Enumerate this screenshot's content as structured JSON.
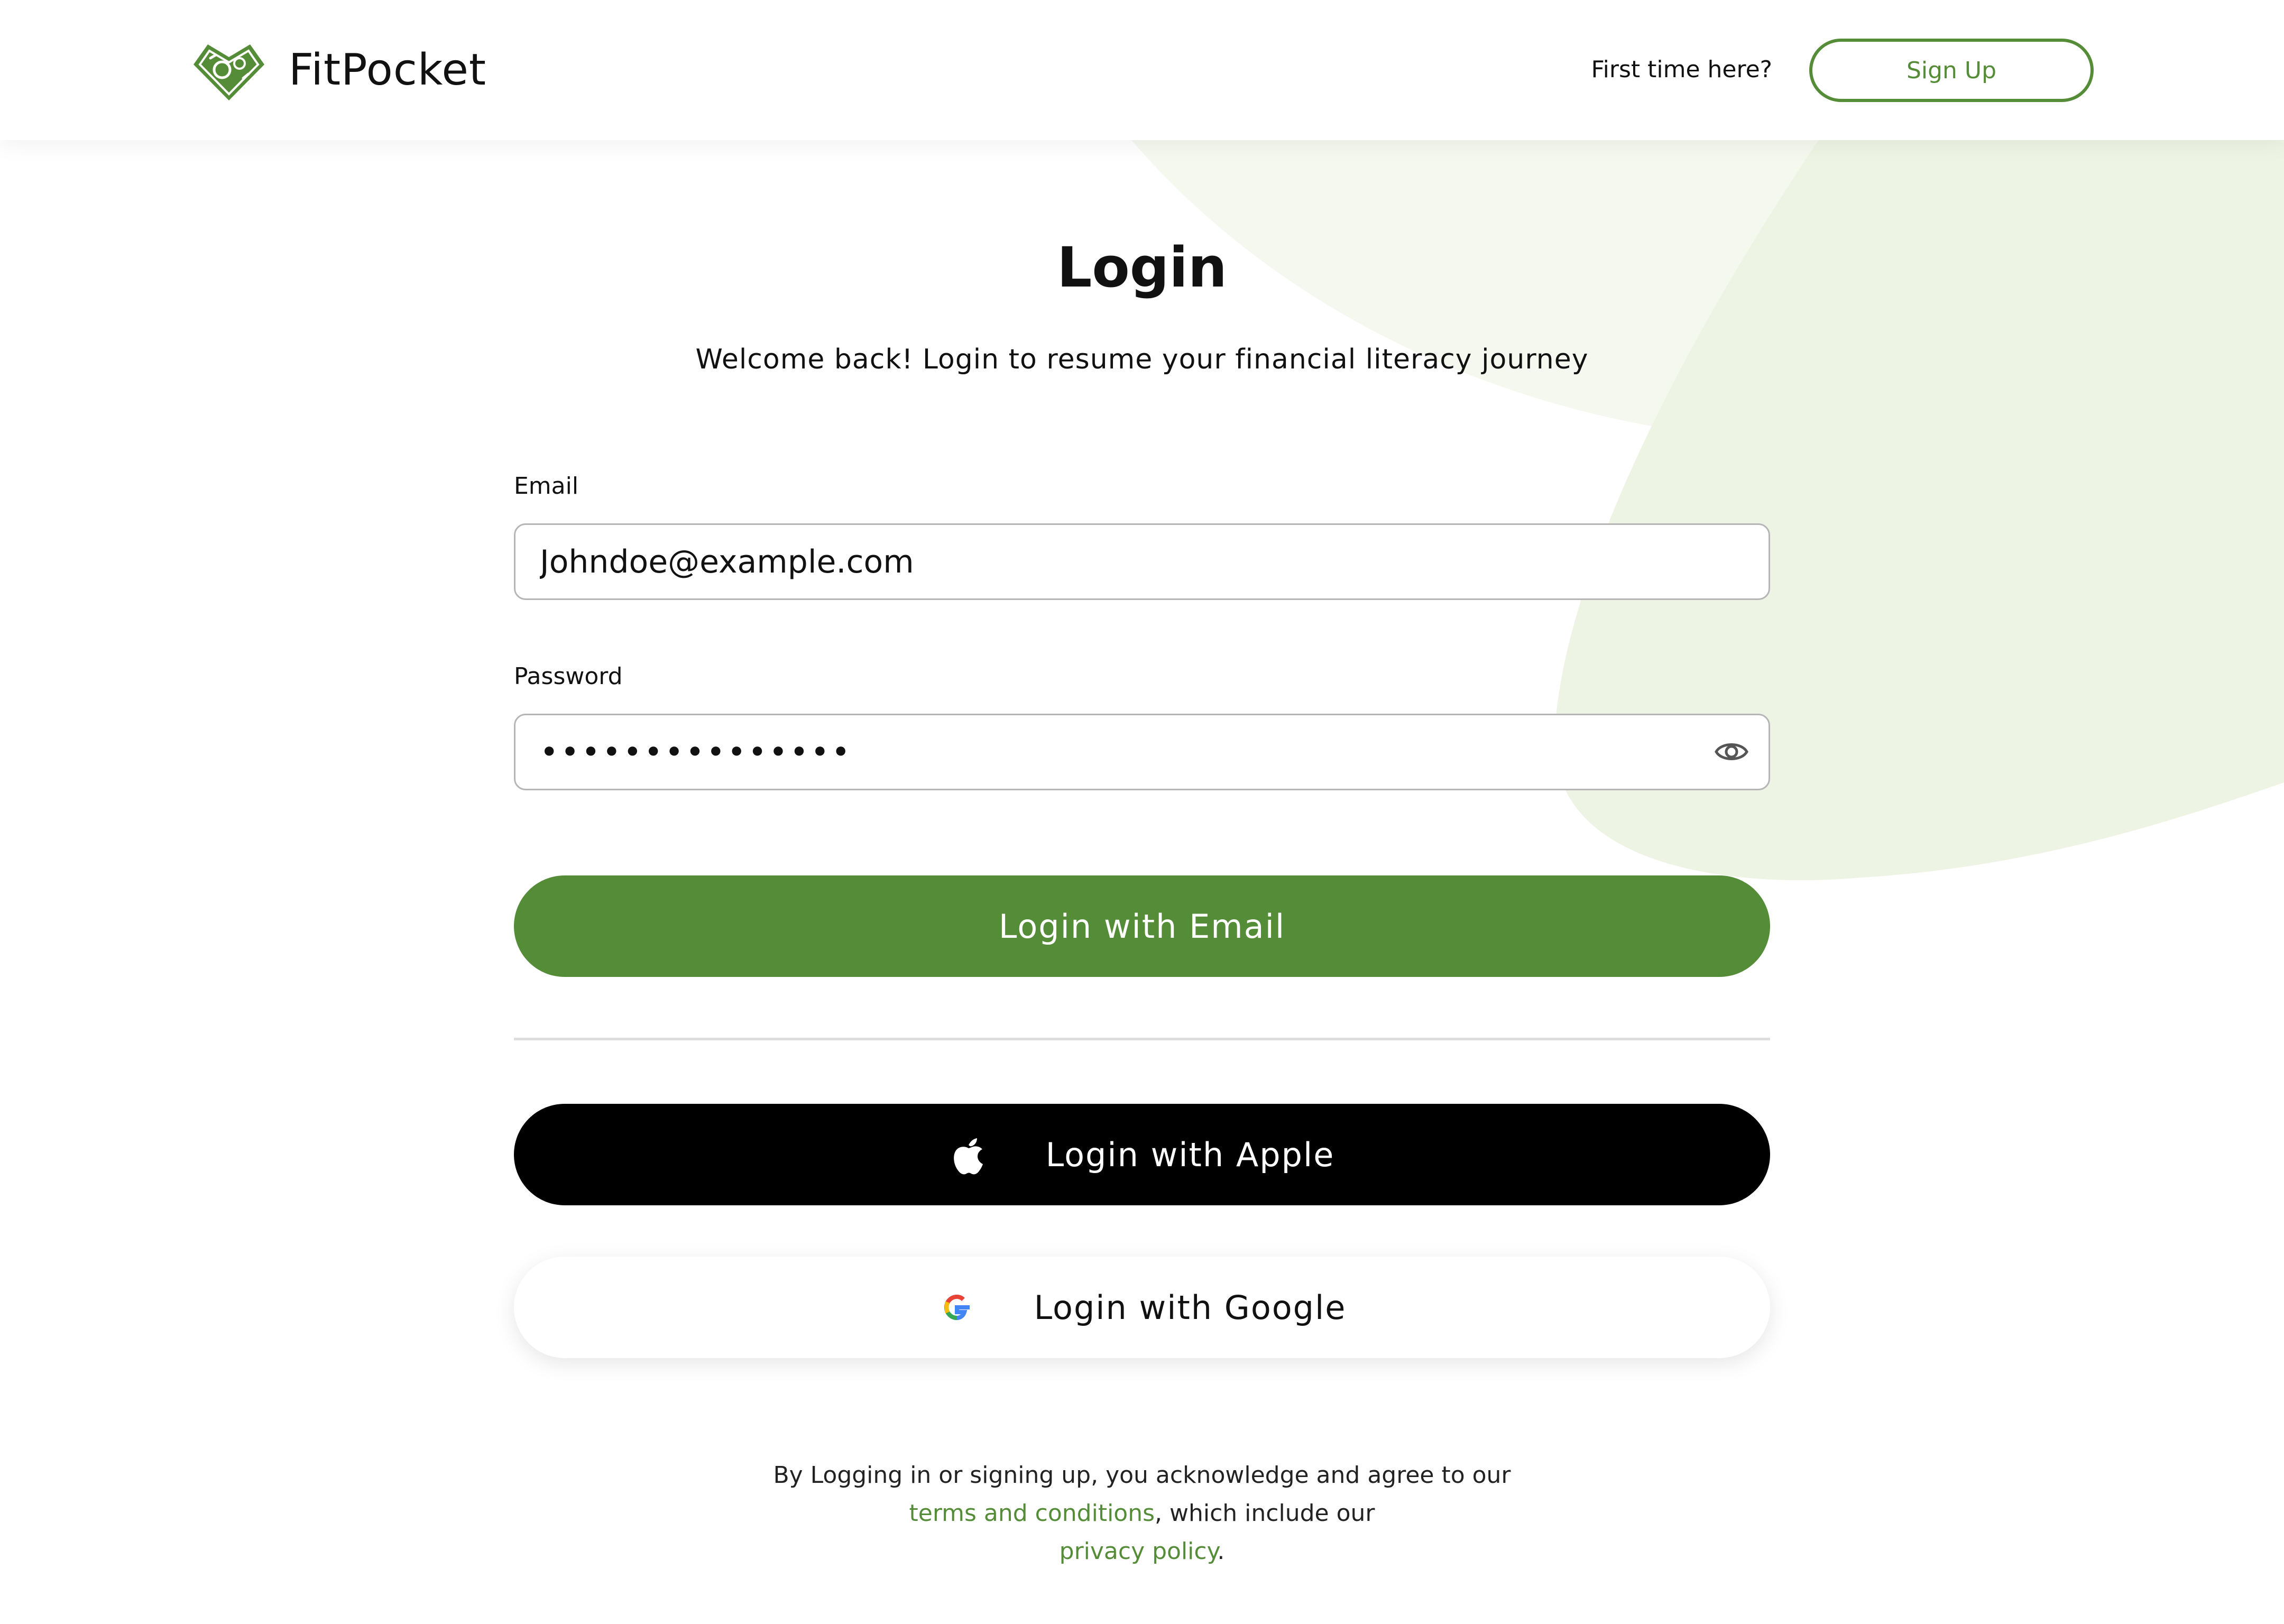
{
  "header": {
    "brand_name": "FitPocket",
    "logo_icon": "money-heart-logo-icon",
    "first_time_text": "First time here?",
    "signup_label": "Sign Up"
  },
  "login": {
    "title": "Login",
    "subtitle": "Welcome back! Login to resume your financial literacy journey",
    "email_label": "Email",
    "email_value": "Johndoe@example.com",
    "password_label": "Password",
    "password_value": "•••••••••••••••",
    "password_toggle_icon": "eye-icon",
    "email_button": "Login with Email",
    "apple_button": "Login with Apple",
    "apple_icon": "apple-icon",
    "google_button": "Login with Google",
    "google_icon": "google-icon"
  },
  "legal": {
    "text_1": "By Logging in or signing up, you acknowledge and agree to our ",
    "terms_link": "terms and conditions",
    "text_2": ", which include our ",
    "privacy_link": "privacy policy",
    "text_3": "."
  },
  "colors": {
    "brand_green": "#558c37",
    "background_blob_light": "#f5f8ee",
    "background_blob": "#eef4e3",
    "apple_button": "#000000",
    "divider": "#dddddd"
  }
}
